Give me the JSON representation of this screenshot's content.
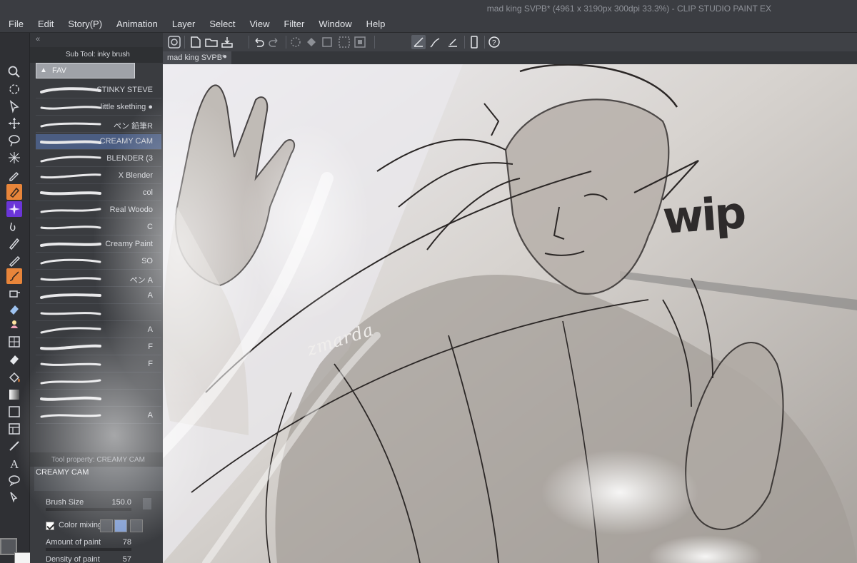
{
  "window": {
    "title": "mad king SVPB* (4961 x 3190px 300dpi 33.3%)  -  CLIP STUDIO PAINT EX"
  },
  "menu": [
    "File",
    "Edit",
    "Story(P)",
    "Animation",
    "Layer",
    "Select",
    "View",
    "Filter",
    "Window",
    "Help"
  ],
  "toolbar": {
    "icons": [
      "clip-studio-icon",
      "new-icon",
      "open-icon",
      "save-icon",
      "undo-icon",
      "redo-icon",
      "clear-icon",
      "fill-icon",
      "transform-icon",
      "selection-icon",
      "snap-icon",
      "ruler-icon",
      "device-icon",
      "help-icon"
    ]
  },
  "document_tab": {
    "label": "mad king SVPB*",
    "close": "●"
  },
  "sub_tool": {
    "header": "Sub Tool: inky brush",
    "fav": "FAV",
    "brushes": [
      {
        "name": "STINKY STEVE"
      },
      {
        "name": "little skething ●"
      },
      {
        "name": "ペン 鉛筆R"
      },
      {
        "name": "CREAMY CAM"
      },
      {
        "name": "BLENDER (3"
      },
      {
        "name": "X Blender"
      },
      {
        "name": "col"
      },
      {
        "name": "Real Woodo"
      },
      {
        "name": "C"
      },
      {
        "name": "Creamy Paint"
      },
      {
        "name": "SO"
      },
      {
        "name": "ペン A"
      },
      {
        "name": "A"
      },
      {
        "name": ""
      },
      {
        "name": "A"
      },
      {
        "name": "F"
      },
      {
        "name": "F"
      },
      {
        "name": ""
      },
      {
        "name": ""
      },
      {
        "name": "A"
      }
    ]
  },
  "tool_property": {
    "header": "Tool property: CREAMY CAM",
    "name": "CREAMY CAM",
    "brush_size_label": "Brush Size",
    "brush_size_value": "150.0",
    "color_mixing_label": "Color mixing",
    "amount_label": "Amount of paint",
    "amount_value": "78",
    "density_label": "Density of paint",
    "density_value": "57"
  },
  "tools": [
    "magnifier-icon",
    "rotate-icon",
    "object-icon",
    "move-icon",
    "lasso-icon",
    "auto-select-icon",
    "eyedropper-icon",
    "pen-icon",
    "decoration-icon",
    "blend-icon",
    "marker-icon",
    "pencil-icon",
    "brush-icon",
    "airbrush-icon",
    "eraser-icon",
    "decoration-2-icon",
    "frame-icon",
    "eraser-2-icon",
    "fill-icon",
    "gradient-icon",
    "figure-icon",
    "frame-border-icon",
    "text-icon",
    "balloon-icon",
    "correction-icon"
  ],
  "canvas": {
    "watermark": "zmarda",
    "wip": "wip"
  },
  "colors": {
    "accent": "#e8853a",
    "selection": "#4b5d82",
    "panel": "#3a3c40",
    "canvas": "#c6c2be"
  }
}
